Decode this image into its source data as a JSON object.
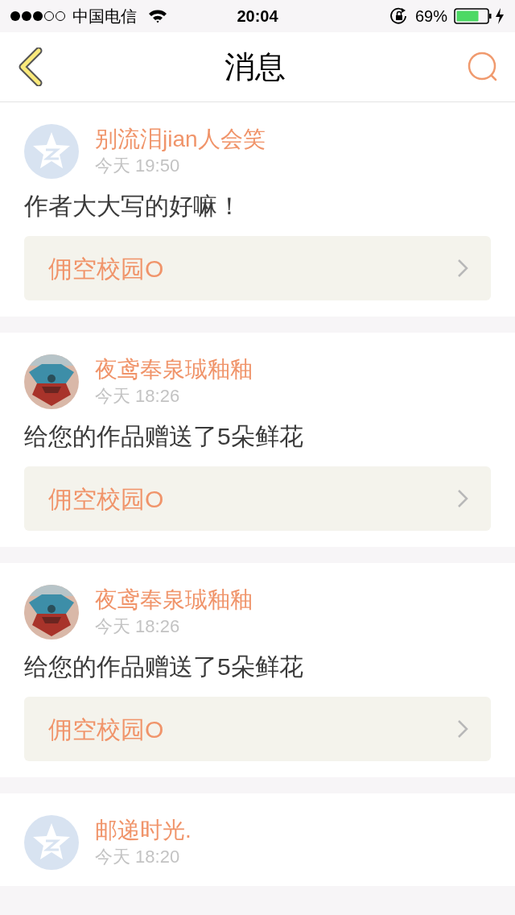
{
  "status_bar": {
    "carrier": "中国电信",
    "time": "20:04",
    "battery": "69%"
  },
  "nav": {
    "title": "消息"
  },
  "messages": [
    {
      "avatar": {
        "kind": "default"
      },
      "name": "别流泪jian人会笑",
      "time": "今天 19:50",
      "text": "作者大大写的好嘛！",
      "link": "佣空校园O"
    },
    {
      "name": "夜鸢奉泉珹釉釉",
      "time": "今天 18:26",
      "text": "给您的作品赠送了5朵鲜花",
      "link": "佣空校园O"
    },
    {
      "name": "夜鸢奉泉珹釉釉",
      "time": "今天 18:26",
      "text": "给您的作品赠送了5朵鲜花",
      "link": "佣空校园O"
    },
    {
      "avatar": {
        "kind": "default"
      },
      "name": "邮递时光.",
      "time": "今天 18:20"
    }
  ]
}
